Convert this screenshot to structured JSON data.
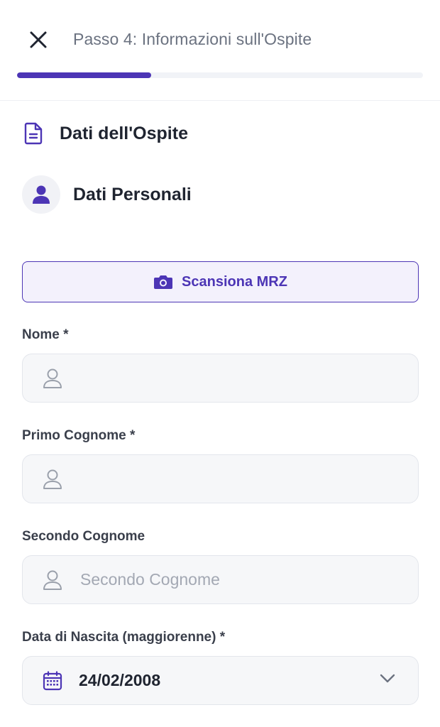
{
  "header": {
    "title": "Passo 4: Informazioni sull'Ospite",
    "progress_fraction": 0.33
  },
  "section": {
    "title": "Dati dell'Ospite"
  },
  "personal": {
    "title": "Dati Personali"
  },
  "scan_button": {
    "label": "Scansiona MRZ"
  },
  "fields": {
    "nome": {
      "label": "Nome *",
      "value": "",
      "placeholder": ""
    },
    "primo_cognome": {
      "label": "Primo Cognome *",
      "value": "",
      "placeholder": ""
    },
    "secondo_cognome": {
      "label": "Secondo Cognome",
      "value": "",
      "placeholder": "Secondo Cognome"
    },
    "data_nascita": {
      "label": "Data di Nascita (maggiorenne) *",
      "value": "24/02/2008"
    }
  },
  "colors": {
    "accent": "#4c35b5",
    "accent_bg": "#f3f1fc",
    "input_bg": "#f6f7f9",
    "text_muted": "#6b7280"
  },
  "icons": {
    "close": "close-icon",
    "document": "document-icon",
    "user": "user-icon",
    "camera": "camera-icon",
    "calendar": "calendar-icon",
    "chevron": "chevron-down-icon"
  }
}
